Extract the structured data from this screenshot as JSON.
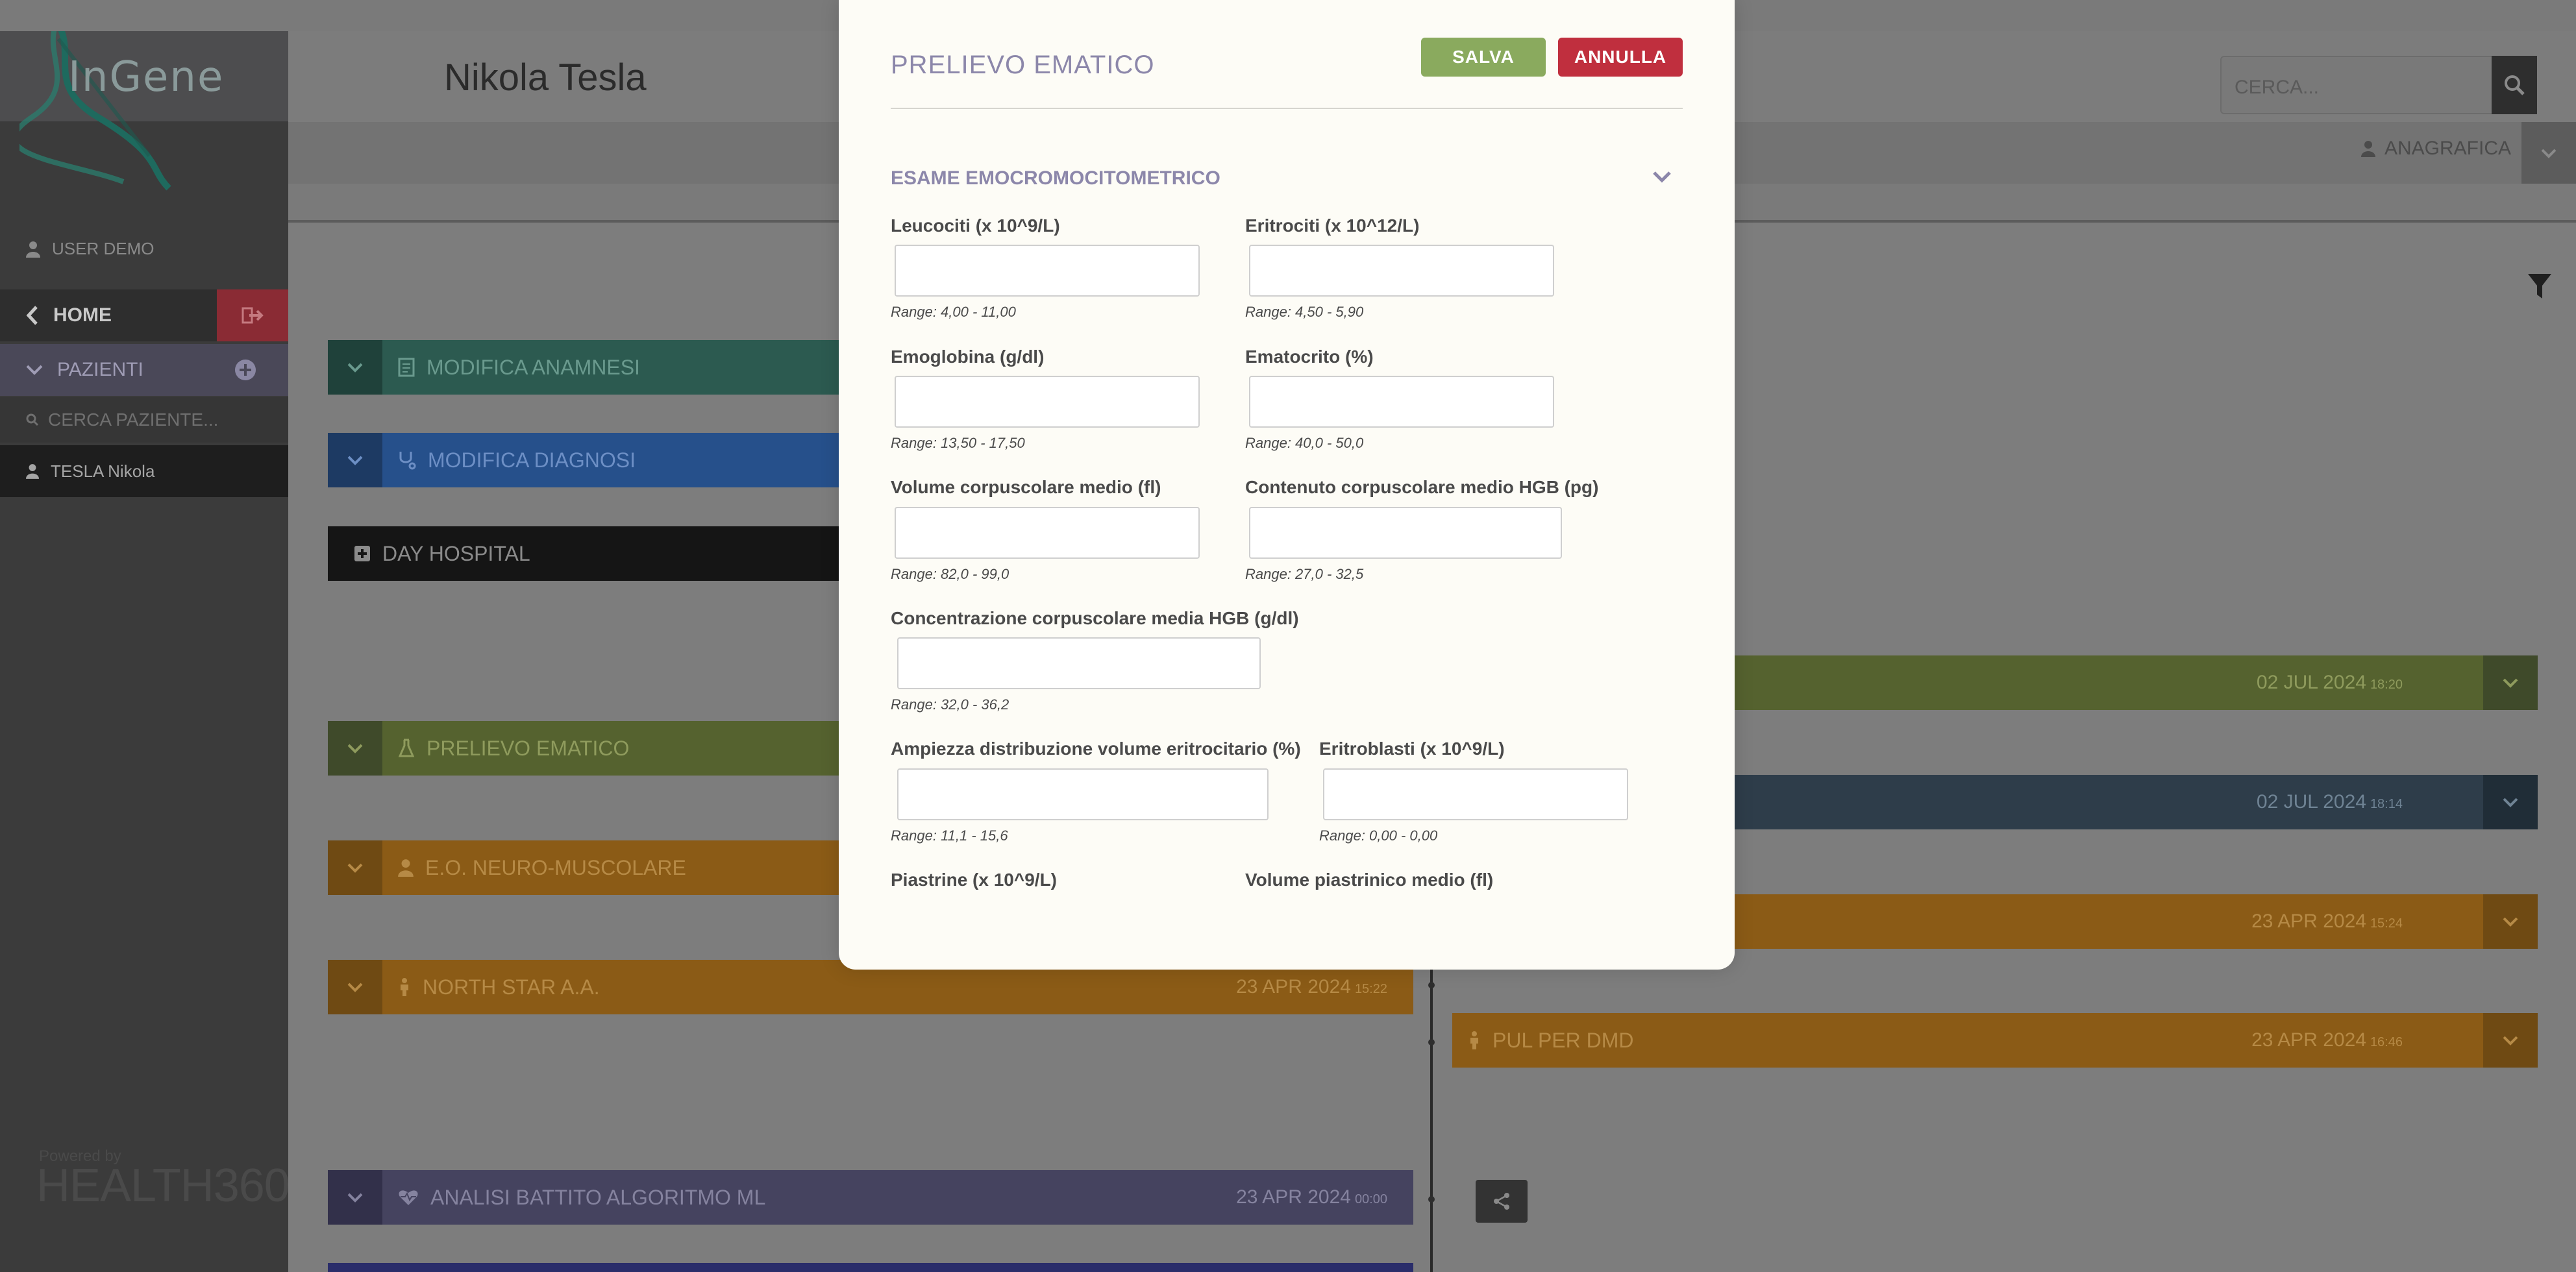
{
  "app": {
    "logo_text": "InGene",
    "patient_name": "Nikola Tesla",
    "search_placeholder": "CERCA...",
    "anagrafica_label": "ANAGRAFICA"
  },
  "sidebar": {
    "user_label": "USER DEMO",
    "home_label": "HOME",
    "patients_label": "PAZIENTI",
    "patient_search_placeholder": "CERCA PAZIENTE...",
    "patient_item": "TESLA Nikola",
    "powered_by": "Powered by",
    "brand": "HEALTH360"
  },
  "timeline": {
    "left_cards": [
      {
        "label": "MODIFICA ANAMNESI"
      },
      {
        "label": "MODIFICA DIAGNOSI"
      },
      {
        "label": "DAY HOSPITAL"
      },
      {
        "label": "PRELIEVO EMATICO"
      },
      {
        "label": "E.O. NEURO-MUSCOLARE"
      },
      {
        "label": "NORTH STAR A.A.",
        "date": "23 APR 2024",
        "time": "15:22"
      },
      {
        "label": "ANALISI BATTITO ALGORITMO ML",
        "date": "23 APR 2024",
        "time": "00:00"
      }
    ],
    "right_cards": [
      {
        "date": "02 JUL 2024",
        "time": "18:20"
      },
      {
        "date": "02 JUL 2024",
        "time": "18:14"
      },
      {
        "date": "23 APR 2024",
        "time": "15:24"
      },
      {
        "label": "PUL PER DMD",
        "date": "23 APR 2024",
        "time": "16:46"
      }
    ]
  },
  "modal": {
    "title": "PRELIEVO EMATICO",
    "save_label": "SALVA",
    "cancel_label": "ANNULLA",
    "section_title": "ESAME EMOCROMOCITOMETRICO",
    "fields": [
      {
        "label": "Leucociti (x 10^9/L)",
        "value": "",
        "range": "Range: 4,00 - 11,00"
      },
      {
        "label": "Eritrociti (x 10^12/L)",
        "value": "",
        "range": "Range: 4,50 - 5,90"
      },
      {
        "label": "Emoglobina (g/dl)",
        "value": "",
        "range": "Range: 13,50 - 17,50"
      },
      {
        "label": "Ematocrito (%)",
        "value": "",
        "range": "Range: 40,0 - 50,0"
      },
      {
        "label": "Volume corpuscolare medio (fl)",
        "value": "",
        "range": "Range: 82,0 - 99,0"
      },
      {
        "label": "Contenuto corpuscolare medio HGB (pg)",
        "value": "",
        "range": "Range: 27,0 - 32,5"
      },
      {
        "label": "Concentrazione corpuscolare media HGB (g/dl)",
        "value": "",
        "range": "Range: 32,0 - 36,2"
      },
      {
        "label": "Ampiezza distribuzione volume eritrocitario (%)",
        "value": "",
        "range": "Range: 11,1 - 15,6"
      },
      {
        "label": "Eritroblasti (x 10^9/L)",
        "value": "",
        "range": "Range: 0,00 - 0,00"
      },
      {
        "label": "Piastrine (x 10^9/L)"
      },
      {
        "label": "Volume piastrinico medio (fl)"
      }
    ]
  },
  "colors": {
    "save": "#8aaa5e",
    "cancel": "#c02f3e",
    "accent": "#8c87aa"
  }
}
